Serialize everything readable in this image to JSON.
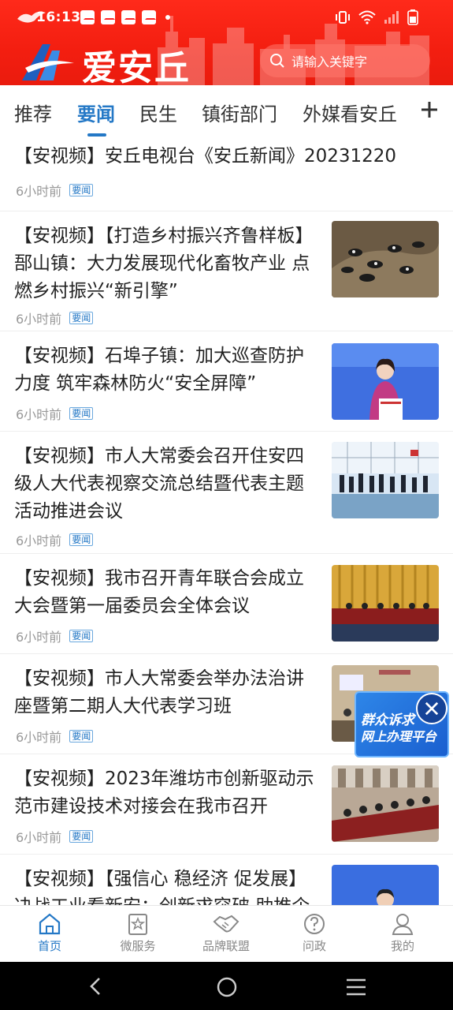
{
  "status_bar": {
    "time": "16:13"
  },
  "header": {
    "app_name": "爱安丘",
    "search_placeholder": "请输入关键字",
    "brand_color": "#f32313"
  },
  "tabs": [
    {
      "label": "推荐",
      "active": false
    },
    {
      "label": "要闻",
      "active": true
    },
    {
      "label": "民生",
      "active": false
    },
    {
      "label": "镇街部门",
      "active": false
    },
    {
      "label": "外媒看安丘",
      "active": false
    }
  ],
  "news": [
    {
      "title": "【安视频】安丘电视台《安丘新闻》20231220",
      "time": "6小时前",
      "tag": "要闻"
    },
    {
      "title": "【安视频】【打造乡村振兴齐鲁样板】郚山镇：大力发展现代化畜牧产业  点燃乡村振兴“新引擎”",
      "time": "6小时前",
      "tag": "要闻"
    },
    {
      "title": "【安视频】石埠子镇：加大巡查防护力度  筑牢森林防火“安全屏障”",
      "time": "6小时前",
      "tag": "要闻"
    },
    {
      "title": "【安视频】市人大常委会召开住安四级人大代表视察交流总结暨代表主题活动推进会议",
      "time": "6小时前",
      "tag": "要闻"
    },
    {
      "title": "【安视频】我市召开青年联合会成立大会暨第一届委员会全体会议",
      "time": "6小时前",
      "tag": "要闻"
    },
    {
      "title": "【安视频】市人大常委会举办法治讲座暨第二期人大代表学习班",
      "time": "6小时前",
      "tag": "要闻"
    },
    {
      "title": "【安视频】2023年潍坊市创新驱动示范市建设技术对接会在我市召开",
      "time": "6小时前",
      "tag": "要闻"
    },
    {
      "title": "【安视频】【强信心  稳经济  促发展】决战工业看新安：创新求突破  助推企",
      "time": "",
      "tag": ""
    }
  ],
  "float_ad": {
    "line1": "群众诉求",
    "line2": "网上办理平台"
  },
  "bottom_nav": [
    {
      "label": "首页",
      "icon": "home-icon",
      "active": true
    },
    {
      "label": "微服务",
      "icon": "star-badge-icon",
      "active": false
    },
    {
      "label": "品牌联盟",
      "icon": "handshake-icon",
      "active": false
    },
    {
      "label": "问政",
      "icon": "question-icon",
      "active": false
    },
    {
      "label": "我的",
      "icon": "user-icon",
      "active": false
    }
  ],
  "accent_color": "#2478c6"
}
